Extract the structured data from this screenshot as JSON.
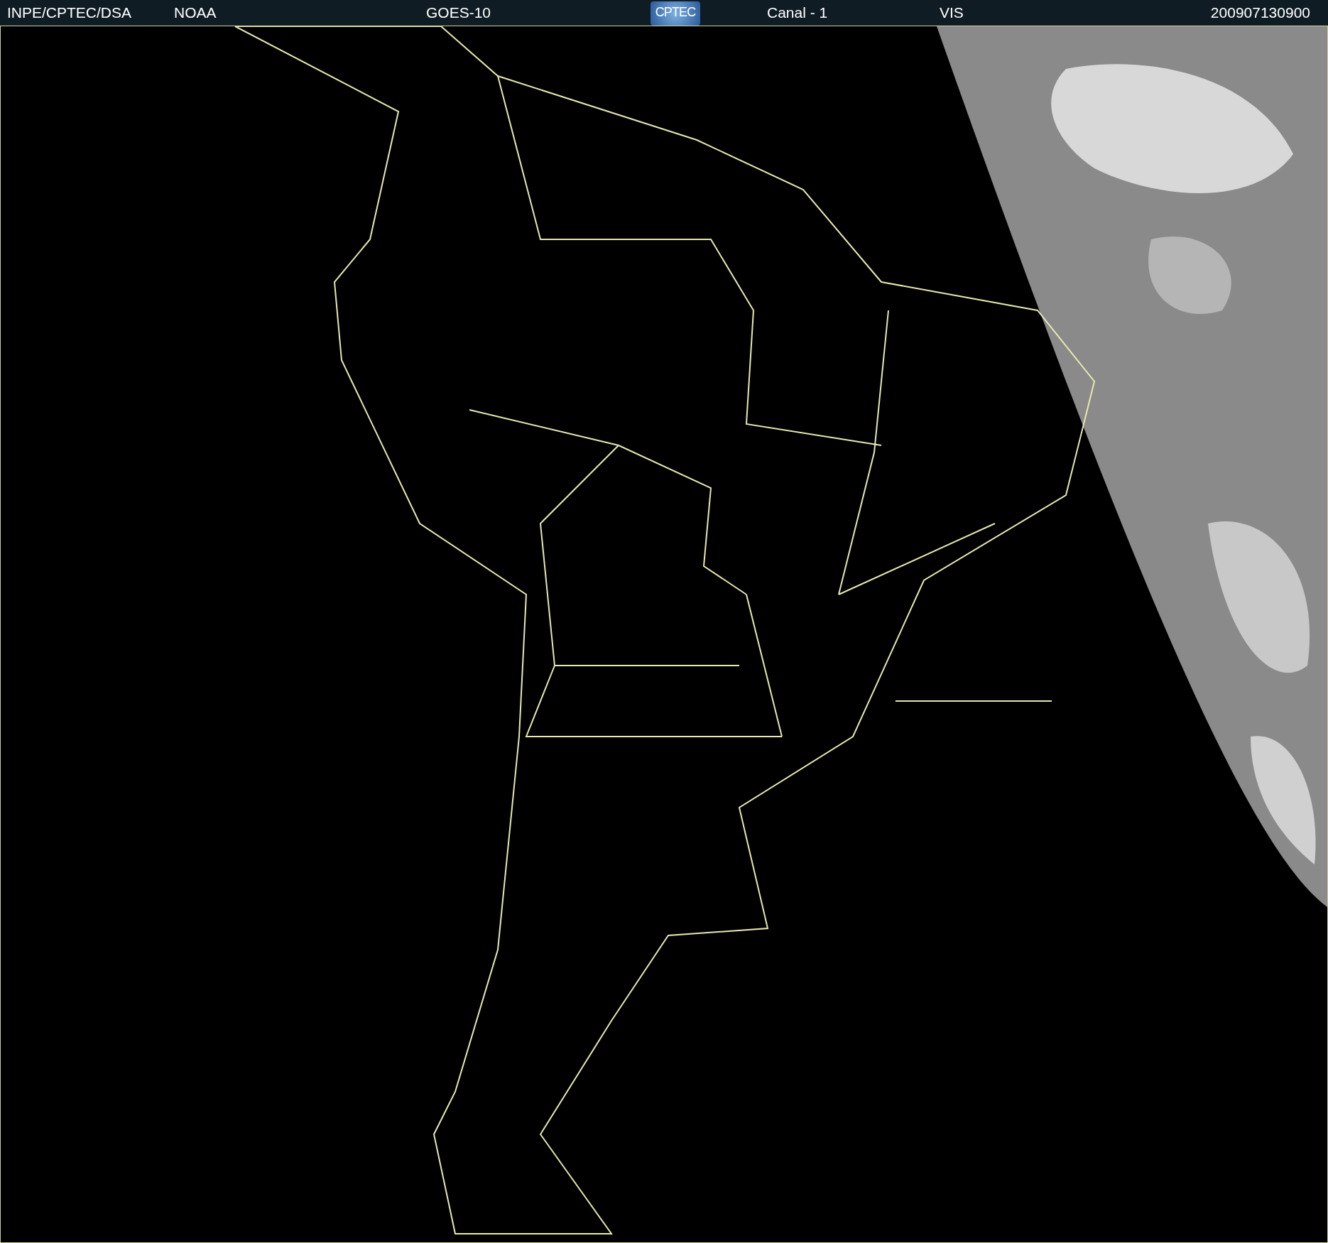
{
  "header": {
    "source": "INPE/CPTEC/DSA",
    "agency": "NOAA",
    "satellite": "GOES-10",
    "logo": "CPTEC",
    "channel": "Canal - 1",
    "band": "VIS",
    "timestamp": "200907130900"
  }
}
